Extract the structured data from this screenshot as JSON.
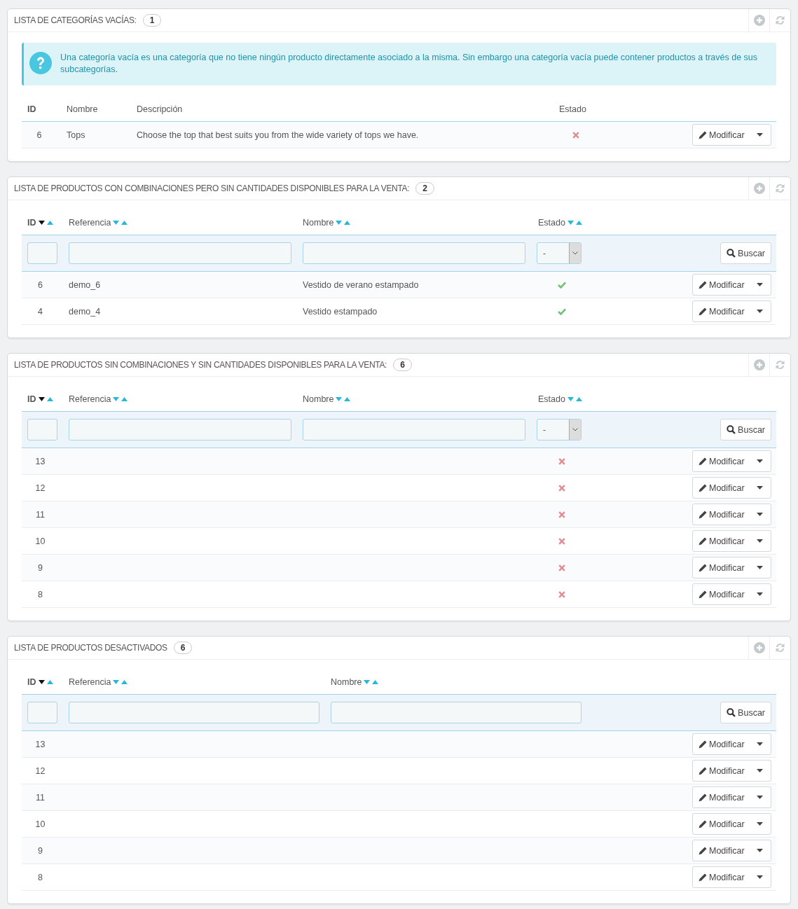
{
  "panels": [
    {
      "title": "LISTA DE CATEGORÍAS VACÍAS:",
      "count": "1",
      "info": "Una categoría vacía es una categoría que no tiene ningún producto directamente asociado a la misma. Sin embargo una categoría vacía puede contener productos a través de sus subcategorías.",
      "columns": [
        {
          "kind": "id",
          "label": "ID"
        },
        {
          "kind": "name",
          "label": "Nombre"
        },
        {
          "kind": "description",
          "label": "Descripción"
        },
        {
          "kind": "status",
          "label": "Estado"
        }
      ],
      "rows": [
        {
          "id": "6",
          "name": "Tops",
          "description": "Choose the top that best suits you from the wide variety of tops we have.",
          "enabled": false,
          "action": "Modificar"
        }
      ]
    },
    {
      "title": "LISTA DE PRODUCTOS CON COMBINACIONES PERO SIN CANTIDADES DISPONIBLES PARA LA VENTA:",
      "count": "2",
      "search_button": "Buscar",
      "columns": [
        {
          "kind": "id",
          "label": "ID",
          "sorted": true,
          "filter": {
            "kind": "text"
          }
        },
        {
          "kind": "reference",
          "label": "Referencia",
          "sorted": false,
          "filter": {
            "kind": "text"
          }
        },
        {
          "kind": "name",
          "label": "Nombre",
          "sorted": false,
          "filter": {
            "kind": "text"
          }
        },
        {
          "kind": "status",
          "label": "Estado",
          "sorted": false,
          "filter": {
            "kind": "select",
            "value": "-"
          }
        }
      ],
      "rows": [
        {
          "id": "6",
          "reference": "demo_6",
          "name": "Vestido de verano estampado",
          "enabled": true,
          "action": "Modificar"
        },
        {
          "id": "4",
          "reference": "demo_4",
          "name": "Vestido estampado",
          "enabled": true,
          "action": "Modificar"
        }
      ]
    },
    {
      "title": "LISTA DE PRODUCTOS SIN COMBINACIONES Y SIN CANTIDADES DISPONIBLES PARA LA VENTA:",
      "count": "6",
      "search_button": "Buscar",
      "columns": [
        {
          "kind": "id",
          "label": "ID",
          "sorted": true,
          "filter": {
            "kind": "text"
          }
        },
        {
          "kind": "reference",
          "label": "Referencia",
          "sorted": false,
          "filter": {
            "kind": "text"
          }
        },
        {
          "kind": "name",
          "label": "Nombre",
          "sorted": false,
          "filter": {
            "kind": "text"
          }
        },
        {
          "kind": "status",
          "label": "Estado",
          "sorted": false,
          "filter": {
            "kind": "select",
            "value": "-"
          }
        }
      ],
      "rows": [
        {
          "id": "13",
          "enabled": false,
          "action": "Modificar"
        },
        {
          "id": "12",
          "enabled": false,
          "action": "Modificar"
        },
        {
          "id": "11",
          "enabled": false,
          "action": "Modificar"
        },
        {
          "id": "10",
          "enabled": false,
          "action": "Modificar"
        },
        {
          "id": "9",
          "enabled": false,
          "action": "Modificar"
        },
        {
          "id": "8",
          "enabled": false,
          "action": "Modificar"
        }
      ]
    },
    {
      "title": "LISTA DE PRODUCTOS DESACTIVADOS",
      "count": "6",
      "search_button": "Buscar",
      "columns": [
        {
          "kind": "id",
          "label": "ID",
          "sorted": true,
          "filter": {
            "kind": "text"
          }
        },
        {
          "kind": "reference",
          "label": "Referencia",
          "sorted": false,
          "filter": {
            "kind": "text"
          }
        },
        {
          "kind": "name",
          "label": "Nombre",
          "sorted": false,
          "filter": {
            "kind": "text"
          }
        }
      ],
      "rows": [
        {
          "id": "13",
          "action": "Modificar"
        },
        {
          "id": "12",
          "action": "Modificar"
        },
        {
          "id": "11",
          "action": "Modificar"
        },
        {
          "id": "10",
          "action": "Modificar"
        },
        {
          "id": "9",
          "action": "Modificar"
        },
        {
          "id": "8",
          "action": "Modificar"
        }
      ]
    }
  ]
}
